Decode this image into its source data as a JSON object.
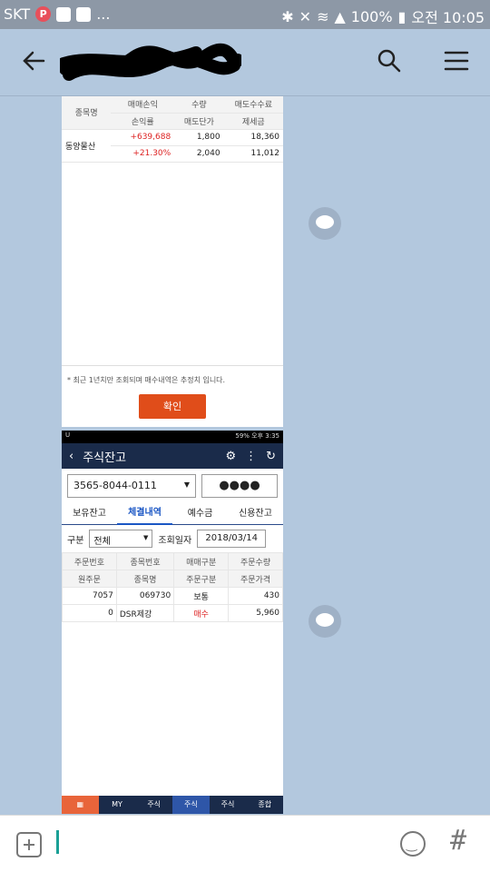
{
  "statusbar": {
    "carrier": "SKT",
    "notif_p": "P",
    "more": "...",
    "battery": "100%",
    "time": "오전 10:05"
  },
  "header": {
    "title_redacted": true
  },
  "screenshot1": {
    "table_headers_row1": [
      "종목명",
      "매매손익",
      "수량",
      "매도수수료"
    ],
    "table_headers_row2": [
      "",
      "손익률",
      "매도단가",
      "제세금"
    ],
    "rows": [
      [
        "동양물산",
        "+639,688",
        "1,800",
        "18,360"
      ],
      [
        "",
        "+21.30%",
        "2,040",
        "11,012"
      ]
    ],
    "note": "* 최근 1년치만 조회되며 매수내역은 추정치 입니다.",
    "confirm_label": "확인"
  },
  "screenshot2": {
    "phone_status_left": "U",
    "phone_status_right": "59% 오후 3:35",
    "nav_title": "주식잔고",
    "account_number": "3565-8044-0111",
    "password_mask": "●●●●",
    "tabs": [
      "보유잔고",
      "체결내역",
      "예수금",
      "신용잔고"
    ],
    "filter_label": "구분",
    "filter_value": "전체",
    "date_label": "조회일자",
    "date_value": "2018/03/14",
    "grid_headers_row1": [
      "주문번호",
      "종목번호",
      "매매구분",
      "주문수량"
    ],
    "grid_headers_row2": [
      "원주문",
      "종목명",
      "주문구분",
      "주문가격"
    ],
    "rows": [
      [
        "7057",
        "069730",
        "보통",
        "430"
      ],
      [
        "0",
        "DSR제강",
        "매수",
        "5,960"
      ]
    ],
    "bottom_nav": [
      "",
      "MY",
      "주식",
      "주식",
      "주식",
      "종합"
    ]
  }
}
